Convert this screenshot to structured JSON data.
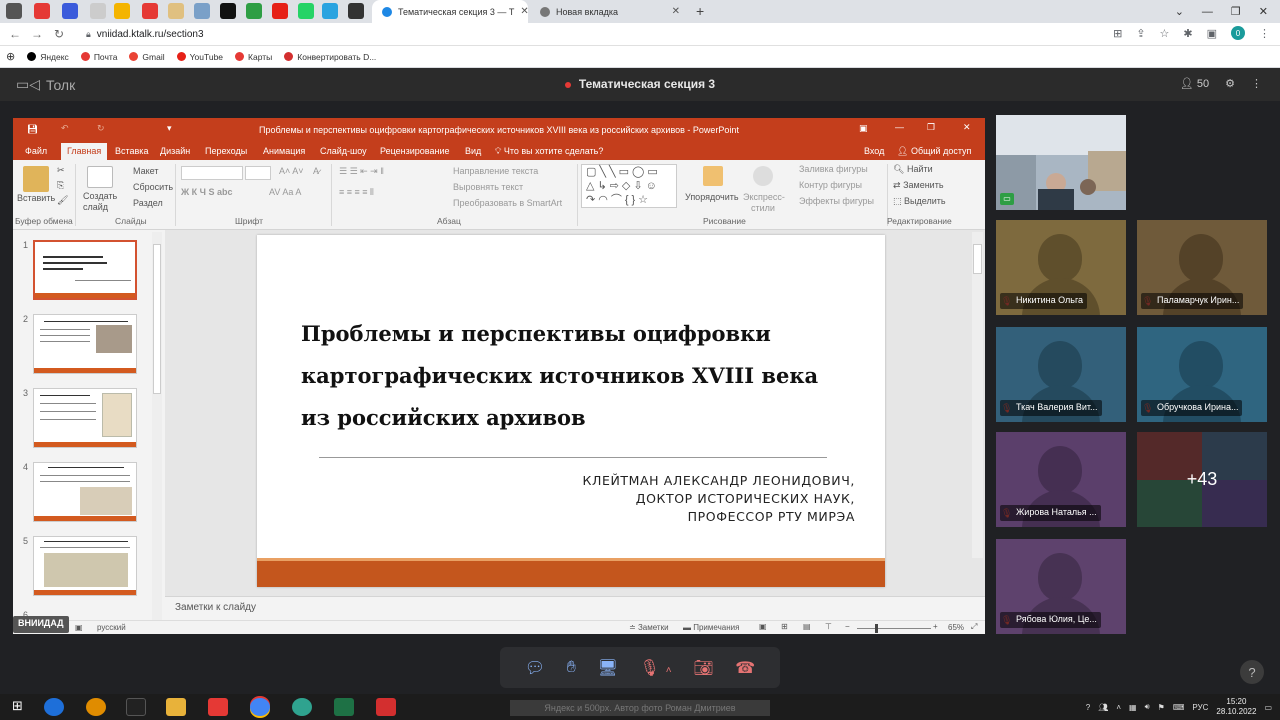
{
  "browser": {
    "tabs": [
      {
        "title": "Тематическая секция 3 — Т",
        "active": true
      },
      {
        "title": "Новая вкладка",
        "active": false
      }
    ],
    "url": "vniidad.ktalk.ru/section3",
    "bookmarks": [
      "Яндекс",
      "Почта",
      "Gmail",
      "YouTube",
      "Карты",
      "Конвертировать D..."
    ],
    "profile_initial": "0"
  },
  "tolk": {
    "app_name": "Толк",
    "meeting_title": "Тематическая секция 3",
    "participants_count": "50"
  },
  "powerpoint": {
    "window_title": "Проблемы и перспективы оцифровки картографических источников XVIII века из российских архивов - PowerPoint",
    "ribbon_tabs": [
      "Файл",
      "Главная",
      "Вставка",
      "Дизайн",
      "Переходы",
      "Анимация",
      "Слайд-шоу",
      "Рецензирование",
      "Вид"
    ],
    "tell_me": "Что вы хотите сделать?",
    "signin": "Вход",
    "share": "Общий доступ",
    "ribbon": {
      "paste": "Вставить",
      "clipboard": "Буфер обмена",
      "new_slide": "Создать слайд",
      "layout": "Макет",
      "reset": "Сбросить",
      "section": "Раздел",
      "slides": "Слайды",
      "font_group": "Шрифт",
      "para_group": "Абзац",
      "text_direction": "Направление текста",
      "align_text": "Выровнять текст",
      "smartart": "Преобразовать в SmartArt",
      "arrange": "Упорядочить",
      "quick_styles": "Экспресс-стили",
      "shape_fill": "Заливка фигуры",
      "shape_outline": "Контур фигуры",
      "shape_effects": "Эффекты фигуры",
      "drawing": "Рисование",
      "find": "Найти",
      "replace": "Заменить",
      "select": "Выделить",
      "editing": "Редактирование"
    },
    "thumb_numbers": [
      "1",
      "2",
      "3",
      "4",
      "5",
      "6"
    ],
    "slide": {
      "title_lines": [
        "Проблемы и перспективы оцифровки",
        "картографических источников XVIII века",
        "из российских архивов"
      ],
      "author_lines": [
        "КЛЕЙТМАН АЛЕКСАНДР ЛЕОНИДОВИЧ,",
        "ДОКТОР ИСТОРИЧЕСКИХ НАУК,",
        "ПРОФЕССОР РТУ МИРЭА"
      ]
    },
    "notes_placeholder": "Заметки к слайду",
    "status": {
      "language": "русский",
      "notes": "Заметки",
      "comments": "Примечания",
      "zoom": "65%"
    },
    "presenter_tag": "ВНИИДАД"
  },
  "participants": [
    {
      "name": "Никитина Ольга",
      "color": "#7e6a3e"
    },
    {
      "name": "Паламарчук Ирин...",
      "color": "#6f5a3a"
    },
    {
      "name": "Ткач Валерия Вит...",
      "color": "#33607a"
    },
    {
      "name": "Обручкова Ирина...",
      "color": "#2f6580"
    },
    {
      "name": "Жирова Наталья ...",
      "color": "#5b3f6b"
    },
    {
      "name": "Рябова Юлия, Це...",
      "color": "#5e426d"
    }
  ],
  "more_participants": "+43",
  "taskbar": {
    "watermark": "Яндекс и 500px. Автор фото Роман Дмитриев",
    "lang": "РУС",
    "time": "15:20",
    "date": "28.10.2022"
  },
  "colors": {
    "ppt_accent": "#c43e1c",
    "slide_band": "#c4561d",
    "tolk_bg": "#202124"
  }
}
